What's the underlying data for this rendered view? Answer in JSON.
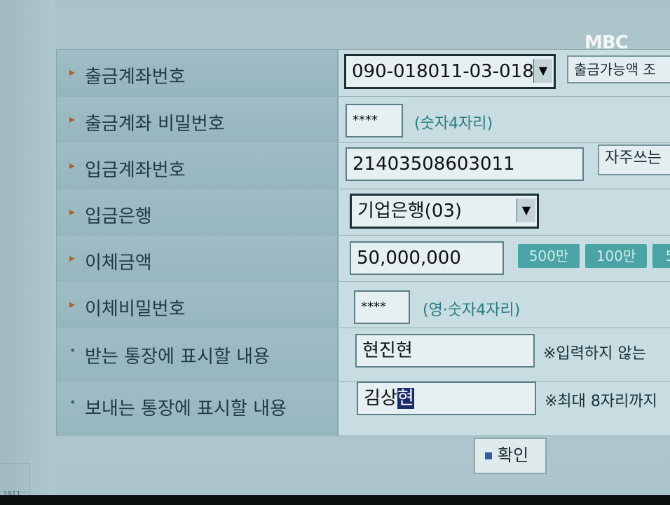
{
  "watermark": "MBC",
  "form": {
    "rows": [
      {
        "label": "출금계좌번호"
      },
      {
        "label": "출금계좌 비밀번호"
      },
      {
        "label": "입금계좌번호"
      },
      {
        "label": "입금은행"
      },
      {
        "label": "이체금액"
      },
      {
        "label": "이체비밀번호"
      },
      {
        "label": "받는 통장에 표시할 내용"
      },
      {
        "label": "보내는 통장에 표시할 내용"
      }
    ],
    "withdraw_account": {
      "value": "090-018011-03-018",
      "button": "출금가능액 조"
    },
    "withdraw_password": {
      "value": "****",
      "hint": "(숫자4자리)"
    },
    "deposit_account": {
      "value": "21403508603011",
      "button": "자주쓰는"
    },
    "deposit_bank": {
      "value": "기업은행(03)"
    },
    "amount": {
      "value": "50,000,000",
      "quick_buttons": [
        "500만",
        "100만",
        "5"
      ]
    },
    "transfer_password": {
      "value": "****",
      "hint": "(영·숫자4자리)"
    },
    "recipient_memo": {
      "value": "현진현",
      "note": "※입력하지 않는"
    },
    "sender_memo": {
      "value_prefix": "김상",
      "value_selected": "현",
      "note": "※최대 8자리까지"
    },
    "confirm_label": "확인"
  },
  "colors": {
    "quick_button_bg": "#4aa3a4",
    "hint_text": "#2c7d83"
  },
  "misc": {
    "fragment_text": "1911"
  }
}
